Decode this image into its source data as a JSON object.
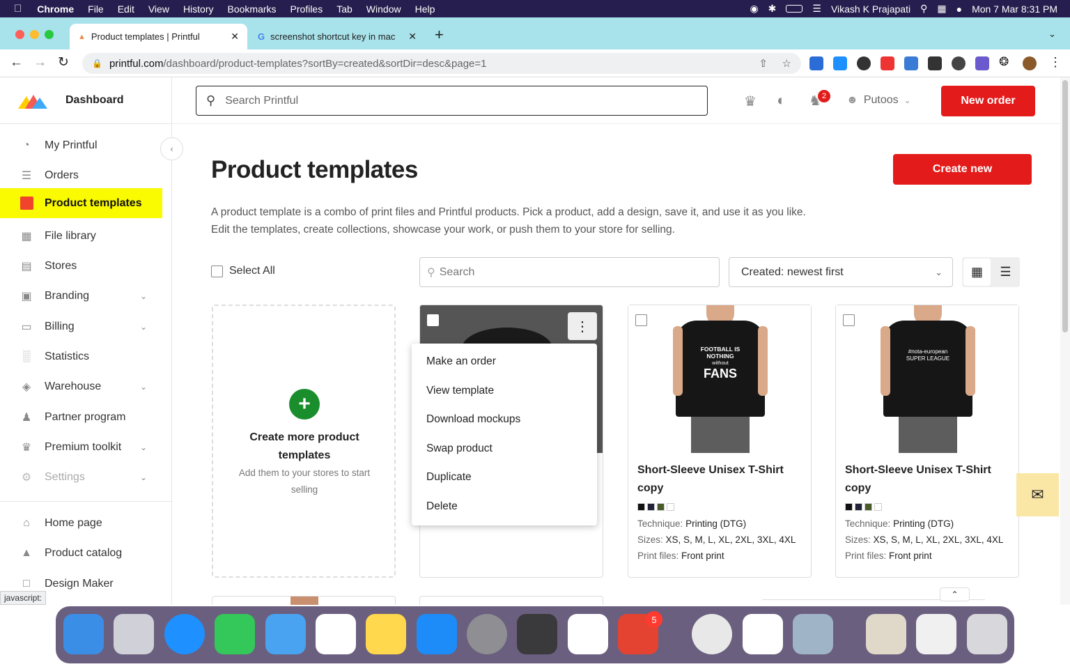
{
  "menubar": {
    "app": "Chrome",
    "items": [
      "File",
      "Edit",
      "View",
      "History",
      "Bookmarks",
      "Profiles",
      "Tab",
      "Window",
      "Help"
    ],
    "user": "Vikash K Prajapati",
    "datetime": "Mon 7 Mar  8:31 PM"
  },
  "tabs": [
    {
      "title": "Product templates | Printful"
    },
    {
      "title": "screenshot shortcut key in mac"
    }
  ],
  "address": {
    "host": "printful.com",
    "path": "/dashboard/product-templates?sortBy=created&sortDir=desc&page=1"
  },
  "sidebar": {
    "brand": "Dashboard",
    "items": [
      {
        "label": "My Printful"
      },
      {
        "label": "Orders"
      },
      {
        "label": "Product templates"
      },
      {
        "label": "File library"
      },
      {
        "label": "Stores"
      },
      {
        "label": "Branding"
      },
      {
        "label": "Billing"
      },
      {
        "label": "Statistics"
      },
      {
        "label": "Warehouse"
      },
      {
        "label": "Partner program"
      },
      {
        "label": "Premium toolkit"
      },
      {
        "label": "Settings"
      }
    ],
    "bottom": [
      {
        "label": "Home page"
      },
      {
        "label": "Product catalog"
      },
      {
        "label": "Design Maker"
      }
    ],
    "status": "javascript:"
  },
  "header": {
    "search_placeholder": "Search Printful",
    "notif_count": "2",
    "account": "Putoos",
    "new_order": "New order"
  },
  "main": {
    "title": "Product templates",
    "create_new": "Create new",
    "description": "A product template is a combo of print files and Printful products. Pick a product, add a design, save it, and use it as you like. Edit the templates, create collections, showcase your work, or push them to your store for selling.",
    "select_all": "Select All",
    "search_placeholder": "Search",
    "sort_value": "Created: newest first"
  },
  "create_card": {
    "title": "Create more product templates",
    "subtitle": "Add them to your stores to start selling"
  },
  "context_menu": [
    "Make an order",
    "View template",
    "Download mockups",
    "Swap product",
    "Duplicate",
    "Delete"
  ],
  "products": [
    {
      "shirt_text_1": "FOOTBALL IS",
      "shirt_text_2": "NOTHING",
      "shirt_text_3": "without",
      "shirt_text_4": "FANS",
      "name": "Short-Sleeve Unisex T-Shirt copy",
      "technique_label": "Technique:",
      "technique": "Printing (DTG)",
      "sizes_label": "Sizes:",
      "sizes": "XS, S, M, L, XL, 2XL, 3XL, 4XL",
      "print_label": "Print files:",
      "print": "Front print"
    },
    {
      "shirt_text_1": "#nota-european",
      "shirt_text_2": "SUPER LEAGUE",
      "name": "Short-Sleeve Unisex T-Shirt copy",
      "technique_label": "Technique:",
      "technique": "Printing (DTG)",
      "sizes_label": "Sizes:",
      "sizes": "XS, S, M, L, XL, 2XL, 3XL, 4XL",
      "print_label": "Print files:",
      "print": "Front print"
    }
  ],
  "swatch_colors": [
    "#111111",
    "#22223a",
    "#4a5a2a",
    "#ffffff"
  ],
  "dock": {
    "todoist_badge": "5"
  },
  "colors": {
    "accent_red": "#e31b1b",
    "active_nav": "#fafa00",
    "tabbar": "#a8e2ea",
    "menubar": "#251e4e"
  }
}
